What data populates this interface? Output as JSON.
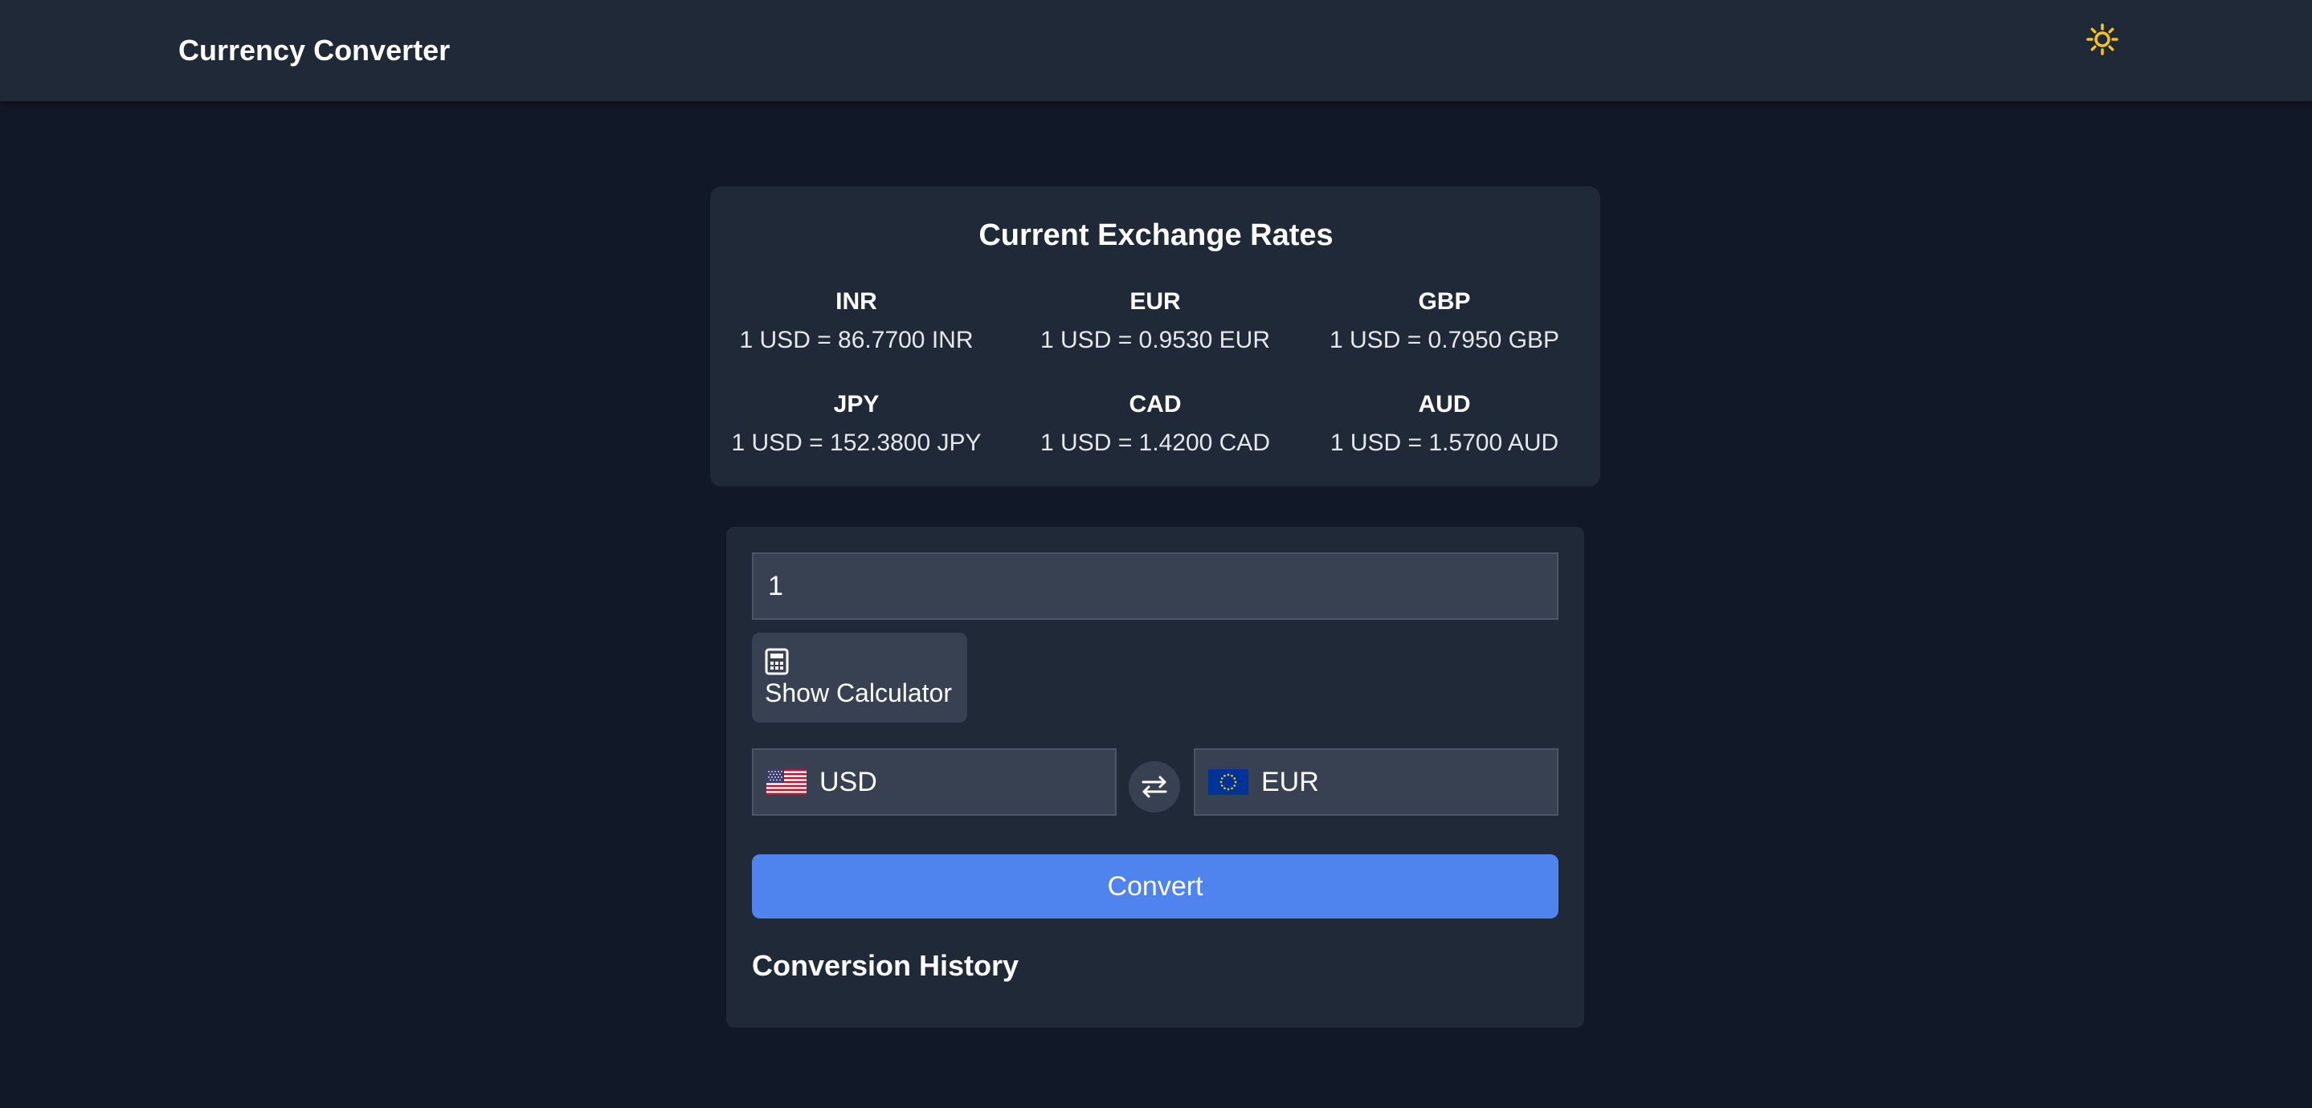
{
  "header": {
    "title": "Currency Converter",
    "theme_icon": "sun-icon",
    "theme_icon_color": "#f5c518"
  },
  "rates": {
    "title": "Current Exchange Rates",
    "items": [
      {
        "code": "INR",
        "value": "1 USD = 86.7700 INR"
      },
      {
        "code": "EUR",
        "value": "1 USD = 0.9530 EUR"
      },
      {
        "code": "GBP",
        "value": "1 USD = 0.7950 GBP"
      },
      {
        "code": "JPY",
        "value": "1 USD = 152.3800 JPY"
      },
      {
        "code": "CAD",
        "value": "1 USD = 1.4200 CAD"
      },
      {
        "code": "AUD",
        "value": "1 USD = 1.5700 AUD"
      }
    ]
  },
  "converter": {
    "amount": "1",
    "calculator_label": "Show Calculator",
    "calculator_icon": "calculator-icon",
    "from_currency": {
      "code": "USD",
      "flag": "us-flag-icon"
    },
    "to_currency": {
      "code": "EUR",
      "flag": "eu-flag-icon"
    },
    "swap_icon": "swap-arrows-icon",
    "convert_label": "Convert",
    "history_title": "Conversion History"
  },
  "colors": {
    "background": "#111827",
    "card": "#1f2937",
    "input": "#374151",
    "accent": "#4f84ef"
  }
}
